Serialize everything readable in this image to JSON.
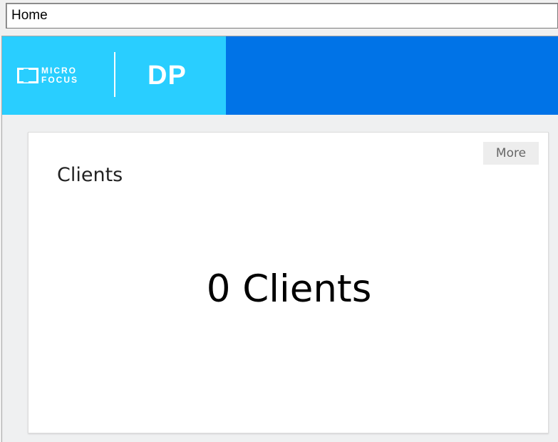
{
  "address_bar": {
    "value": "Home"
  },
  "header": {
    "logo": {
      "line1": "MICRO",
      "line2": "FOCUS",
      "icon": "micro-focus-logo-icon"
    },
    "product_name": "DP"
  },
  "card": {
    "more_label": "More",
    "title": "Clients",
    "count_text": "0 Clients"
  },
  "colors": {
    "brand_block": "#29ceff",
    "header": "#0073e7",
    "page_background": "#eff0f1",
    "card_background": "#ffffff",
    "more_button_background": "#ededed"
  }
}
